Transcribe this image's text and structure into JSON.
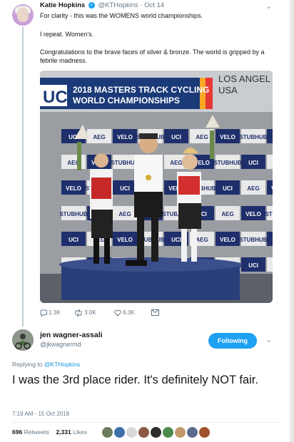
{
  "quoted_tweet": {
    "author_name": "Katie Hopkins",
    "handle": "@KTHopkins",
    "date": "Oct 14",
    "text_lines": [
      "For clarity - this was the WOMENS world championships.",
      "I repeat. Women's.",
      "Congratulations to the brave faces of silver & bronze. The world is gripped by a",
      "febrile madness."
    ],
    "photo": {
      "banner_line1": "2018 MASTERS TRACK CYCLING",
      "banner_line2": "WORLD CHAMPIONSHIPS",
      "banner_logo": "UCI",
      "location_line1": "LOS ANGEL",
      "location_line2": "USA",
      "sponsor_logos": [
        "UCI",
        "AEG",
        "VELO",
        "STUBHUB"
      ]
    },
    "actions": {
      "replies": "1.3K",
      "retweets": "3.0K",
      "likes": "6.3K"
    },
    "icons": [
      "reply-icon",
      "retweet-icon",
      "like-icon",
      "message-icon",
      "chevron-down-icon",
      "verified-icon"
    ]
  },
  "reply_tweet": {
    "author_name": "jen wagner-assali",
    "handle": "@jkwagnermd",
    "follow_label": "Following",
    "replying_label": "Replying to",
    "replying_to": "@KTHopkins",
    "text": "I was the 3rd place rider. It's definitely NOT fair.",
    "timestamp": "7:19 AM - 15 Oct 2018",
    "retweets_count": "696",
    "retweets_label": "Retweets",
    "likes_count": "2,331",
    "likes_label": "Likes"
  },
  "colors": {
    "accent": "#1da1f2",
    "secondary_text": "#657786",
    "primary_text": "#14171a"
  }
}
